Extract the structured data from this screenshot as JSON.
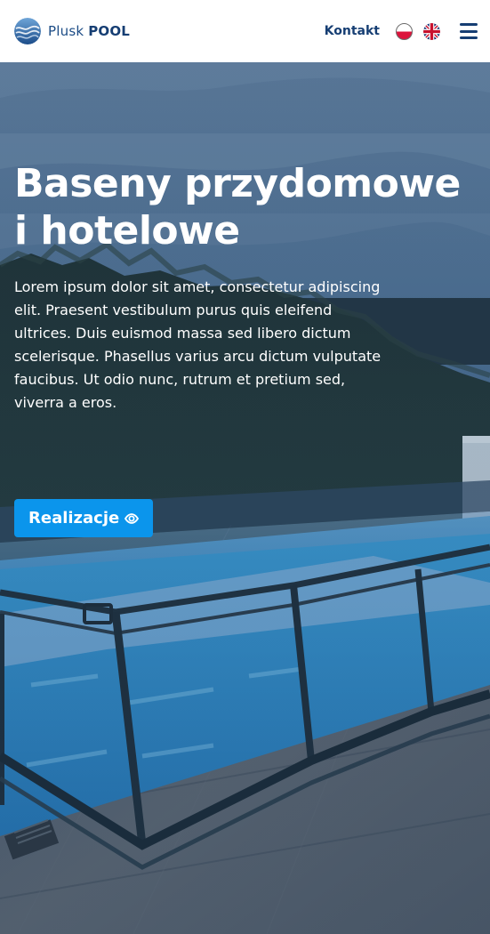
{
  "header": {
    "logo_icon": "pool-wave-logo-icon",
    "brand_prefix": "Plusk ",
    "brand_strong": "POOL",
    "nav_link": "Kontakt",
    "language_flags": [
      "pl-flag-icon",
      "gb-flag-icon"
    ],
    "menu_icon": "hamburger-menu-icon"
  },
  "hero": {
    "title_line_1": "Baseny przydomowe",
    "title_line_2": "i hotelowe",
    "text": "Lorem ipsum dolor sit amet, consectetur adipiscing elit. Praesent vestibulum purus quis eleifend ultrices. Duis euismod massa sed libero dictum scelerisque. Phasellus varius arcu dictum vulputate faucibus. Ut odio nunc, rutrum et pretium sed, viverra a eros.",
    "cta_label": "Realizacje",
    "cta_icon": "eye-icon"
  },
  "colors": {
    "brand_blue": "#163e73",
    "button_blue": "#0b95ec",
    "hero_overlay": "#1f4a73"
  }
}
